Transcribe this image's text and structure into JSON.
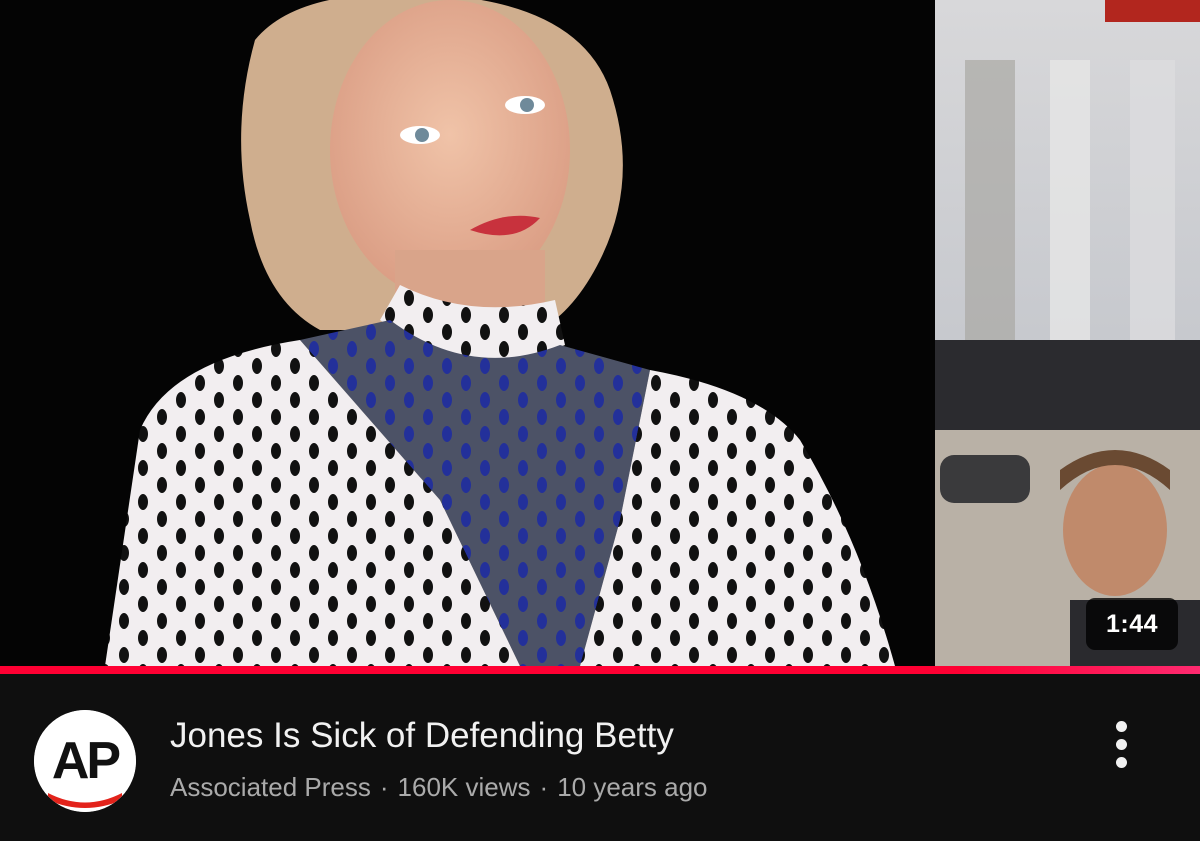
{
  "video": {
    "title": "Jones Is Sick of Defending Betty",
    "channel": "Associated Press",
    "views": "160K views",
    "age": "10 years ago",
    "separator": "·",
    "duration": "1:44",
    "watched_fraction": 1.0
  },
  "avatar": {
    "logo_text": "AP",
    "accent_color": "#e3231b"
  },
  "icons": {
    "menu": "more-vert-icon"
  },
  "colors": {
    "background": "#0f0f0f",
    "progress": "#ff0033",
    "title": "#f1f1f1",
    "subtitle": "#aaaaaa"
  }
}
